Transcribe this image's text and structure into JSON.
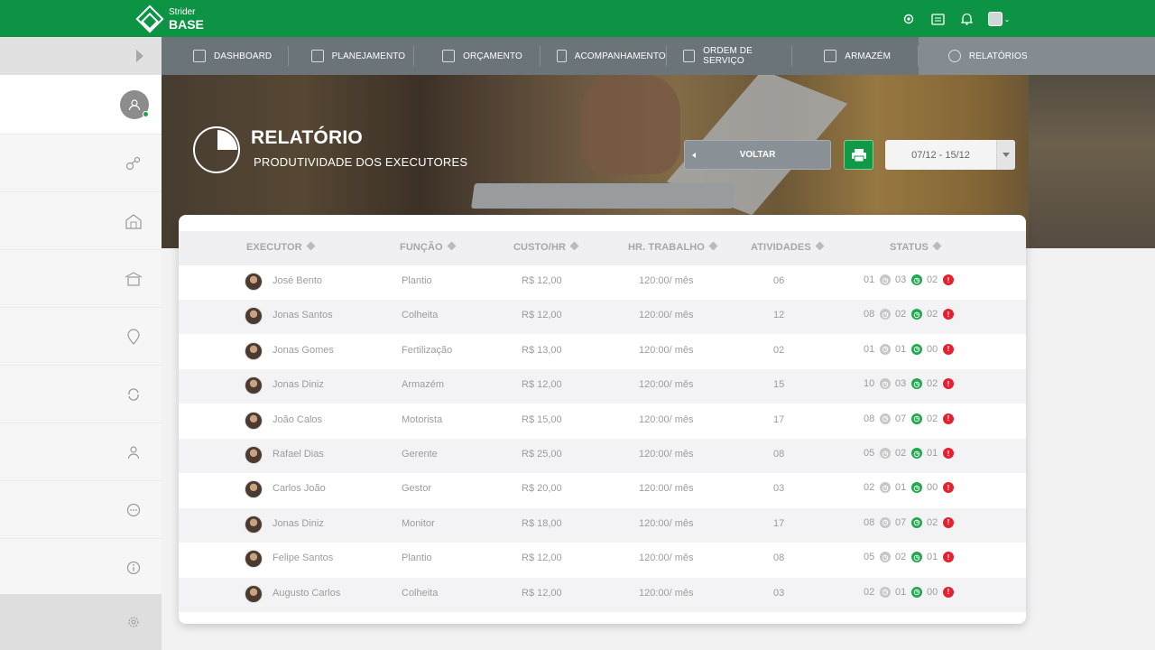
{
  "app": {
    "logo_small": "Strider",
    "logo_big": "BASE"
  },
  "top_icons": [
    "gear-icon",
    "card-icon",
    "bell-icon",
    "user-menu-icon"
  ],
  "nav": [
    {
      "label": "DASHBOARD",
      "icon": "dashboard-icon"
    },
    {
      "label": "PLANEJAMENTO",
      "icon": "clipboard-icon"
    },
    {
      "label": "ORÇAMENTO",
      "icon": "budget-icon"
    },
    {
      "label": "ACOMPANHAMENTO",
      "icon": "checklist-icon"
    },
    {
      "label": "ORDEM DE SERVIÇO",
      "icon": "plant-icon"
    },
    {
      "label": "ARMAZÉM",
      "icon": "warehouse-icon"
    },
    {
      "label": "RELATÓRIOS",
      "icon": "pie-chart-icon"
    }
  ],
  "header": {
    "title": "RELATÓRIO",
    "subtitle": "PRODUTIVIDADE DOS EXECUTORES",
    "back_label": "VOLTAR",
    "date_range": "07/12 - 15/12"
  },
  "table": {
    "columns": [
      "EXECUTOR",
      "FUNÇÃO",
      "CUSTO/HR",
      "HR. TRABALHO",
      "ATIVIDADES",
      "STATUS"
    ],
    "rows": [
      {
        "name": "José Bento",
        "role": "Plantio",
        "cost": "R$ 12,00",
        "hours": "120:00/ mês",
        "activities": "06",
        "s1": "01",
        "s2": "03",
        "s3": "02"
      },
      {
        "name": "Jonas Santos",
        "role": "Colheita",
        "cost": "R$ 12,00",
        "hours": "120:00/ mês",
        "activities": "12",
        "s1": "08",
        "s2": "02",
        "s3": "02"
      },
      {
        "name": "Jonas Gomes",
        "role": "Fertilização",
        "cost": "R$ 13,00",
        "hours": "120:00/ mês",
        "activities": "02",
        "s1": "01",
        "s2": "01",
        "s3": "00"
      },
      {
        "name": "Jonas Diniz",
        "role": "Armazém",
        "cost": "R$ 12,00",
        "hours": "120:00/ mês",
        "activities": "15",
        "s1": "10",
        "s2": "03",
        "s3": "02"
      },
      {
        "name": "João Calos",
        "role": "Motorista",
        "cost": "R$ 15,00",
        "hours": "120:00/ mês",
        "activities": "17",
        "s1": "08",
        "s2": "07",
        "s3": "02"
      },
      {
        "name": "Rafael Dias",
        "role": "Gerente",
        "cost": "R$ 25,00",
        "hours": "120:00/ mês",
        "activities": "08",
        "s1": "05",
        "s2": "02",
        "s3": "01"
      },
      {
        "name": "Carlos João",
        "role": "Gestor",
        "cost": "R$ 20,00",
        "hours": "120:00/ mês",
        "activities": "03",
        "s1": "02",
        "s2": "01",
        "s3": "00"
      },
      {
        "name": "Jonas Diniz",
        "role": "Monitor",
        "cost": "R$ 18,00",
        "hours": "120:00/ mês",
        "activities": "17",
        "s1": "08",
        "s2": "07",
        "s3": "02"
      },
      {
        "name": "Felipe Santos",
        "role": "Plantio",
        "cost": "R$ 12,00",
        "hours": "120:00/ mês",
        "activities": "08",
        "s1": "05",
        "s2": "02",
        "s3": "01"
      },
      {
        "name": "Augusto Carlos",
        "role": "Colheita",
        "cost": "R$ 12,00",
        "hours": "120:00/ mês",
        "activities": "03",
        "s1": "02",
        "s2": "01",
        "s3": "00"
      }
    ]
  },
  "sidebar_icons": [
    "user-avatar",
    "tractor-icon",
    "barn-icon",
    "warehouse-icon",
    "location-pin-icon",
    "refresh-icon",
    "person-icon",
    "more-icon",
    "info-icon",
    "settings-icon"
  ],
  "colors": {
    "brand_green": "#0c9444",
    "nav_grey": "#6b7479",
    "status_red": "#e6202e",
    "status_green": "#21a84e"
  }
}
